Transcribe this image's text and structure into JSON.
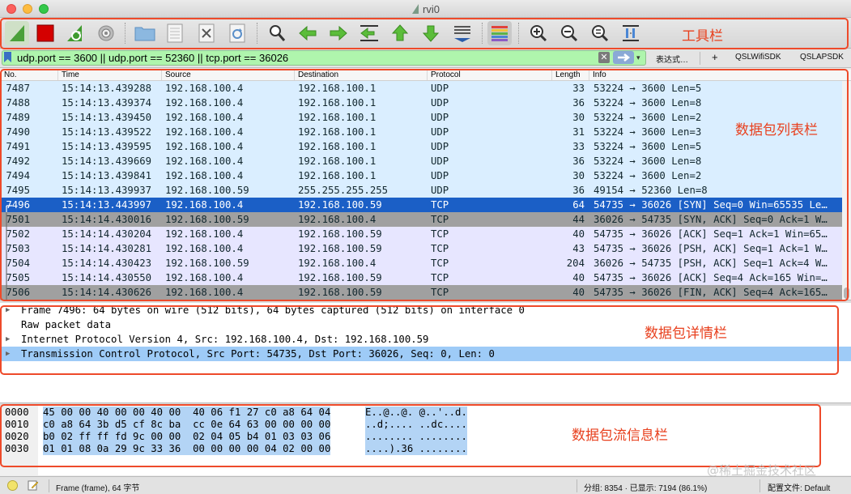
{
  "window": {
    "title": "rvi0"
  },
  "filter": {
    "value": "udp.port == 3600 || udp.port == 52360 || tcp.port == 36026",
    "expression_label": "表达式…",
    "add_label": "+",
    "buttons": [
      "QSLWifiSDK",
      "QSLAPSDK"
    ]
  },
  "columns": [
    "No.",
    "Time",
    "Source",
    "Destination",
    "Protocol",
    "Length",
    "Info"
  ],
  "packets": [
    {
      "no": "7487",
      "time": "15:14:13.439288",
      "src": "192.168.100.4",
      "dst": "192.168.100.1",
      "proto": "UDP",
      "len": "33",
      "info": "53224 → 3600 Len=5",
      "bg": "#daeeff",
      "fg": "#12272e"
    },
    {
      "no": "7488",
      "time": "15:14:13.439374",
      "src": "192.168.100.4",
      "dst": "192.168.100.1",
      "proto": "UDP",
      "len": "36",
      "info": "53224 → 3600 Len=8",
      "bg": "#daeeff",
      "fg": "#12272e"
    },
    {
      "no": "7489",
      "time": "15:14:13.439450",
      "src": "192.168.100.4",
      "dst": "192.168.100.1",
      "proto": "UDP",
      "len": "30",
      "info": "53224 → 3600 Len=2",
      "bg": "#daeeff",
      "fg": "#12272e"
    },
    {
      "no": "7490",
      "time": "15:14:13.439522",
      "src": "192.168.100.4",
      "dst": "192.168.100.1",
      "proto": "UDP",
      "len": "31",
      "info": "53224 → 3600 Len=3",
      "bg": "#daeeff",
      "fg": "#12272e"
    },
    {
      "no": "7491",
      "time": "15:14:13.439595",
      "src": "192.168.100.4",
      "dst": "192.168.100.1",
      "proto": "UDP",
      "len": "33",
      "info": "53224 → 3600 Len=5",
      "bg": "#daeeff",
      "fg": "#12272e"
    },
    {
      "no": "7492",
      "time": "15:14:13.439669",
      "src": "192.168.100.4",
      "dst": "192.168.100.1",
      "proto": "UDP",
      "len": "36",
      "info": "53224 → 3600 Len=8",
      "bg": "#daeeff",
      "fg": "#12272e"
    },
    {
      "no": "7494",
      "time": "15:14:13.439841",
      "src": "192.168.100.4",
      "dst": "192.168.100.1",
      "proto": "UDP",
      "len": "30",
      "info": "53224 → 3600 Len=2",
      "bg": "#daeeff",
      "fg": "#12272e"
    },
    {
      "no": "7495",
      "time": "15:14:13.439937",
      "src": "192.168.100.59",
      "dst": "255.255.255.255",
      "proto": "UDP",
      "len": "36",
      "info": "49154 → 52360 Len=8",
      "bg": "#daeeff",
      "fg": "#12272e"
    },
    {
      "no": "7496",
      "time": "15:14:13.443997",
      "src": "192.168.100.4",
      "dst": "192.168.100.59",
      "proto": "TCP",
      "len": "64",
      "info": "54735 → 36026 [SYN] Seq=0 Win=65535 Le…",
      "bg": "#1b5fc6",
      "fg": "#ffffff"
    },
    {
      "no": "7501",
      "time": "15:14:14.430016",
      "src": "192.168.100.59",
      "dst": "192.168.100.4",
      "proto": "TCP",
      "len": "44",
      "info": "36026 → 54735 [SYN, ACK] Seq=0 Ack=1 W…",
      "bg": "#a0a0a0",
      "fg": "#12272e"
    },
    {
      "no": "7502",
      "time": "15:14:14.430204",
      "src": "192.168.100.4",
      "dst": "192.168.100.59",
      "proto": "TCP",
      "len": "40",
      "info": "54735 → 36026 [ACK] Seq=1 Ack=1 Win=65…",
      "bg": "#e7e6ff",
      "fg": "#12272e"
    },
    {
      "no": "7503",
      "time": "15:14:14.430281",
      "src": "192.168.100.4",
      "dst": "192.168.100.59",
      "proto": "TCP",
      "len": "43",
      "info": "54735 → 36026 [PSH, ACK] Seq=1 Ack=1 W…",
      "bg": "#e7e6ff",
      "fg": "#12272e"
    },
    {
      "no": "7504",
      "time": "15:14:14.430423",
      "src": "192.168.100.59",
      "dst": "192.168.100.4",
      "proto": "TCP",
      "len": "204",
      "info": "36026 → 54735 [PSH, ACK] Seq=1 Ack=4 W…",
      "bg": "#e7e6ff",
      "fg": "#12272e"
    },
    {
      "no": "7505",
      "time": "15:14:14.430550",
      "src": "192.168.100.4",
      "dst": "192.168.100.59",
      "proto": "TCP",
      "len": "40",
      "info": "54735 → 36026 [ACK] Seq=4 Ack=165 Win=…",
      "bg": "#e7e6ff",
      "fg": "#12272e"
    },
    {
      "no": "7506",
      "time": "15:14:14.430626",
      "src": "192.168.100.4",
      "dst": "192.168.100.59",
      "proto": "TCP",
      "len": "40",
      "info": "54735 → 36026 [FIN, ACK] Seq=4 Ack=165…",
      "bg": "#a0a0a0",
      "fg": "#12272e"
    }
  ],
  "details": [
    {
      "text": "Frame 7496: 64 bytes on wire (512 bits), 64 bytes captured (512 bits) on interface 0",
      "expandable": true,
      "selected": false
    },
    {
      "text": "Raw packet data",
      "expandable": false,
      "selected": false
    },
    {
      "text": "Internet Protocol Version 4, Src: 192.168.100.4, Dst: 192.168.100.59",
      "expandable": true,
      "selected": false
    },
    {
      "text": "Transmission Control Protocol, Src Port: 54735, Dst Port: 36026, Seq: 0, Len: 0",
      "expandable": true,
      "selected": true
    }
  ],
  "bytes": [
    {
      "offset": "0000",
      "hex": "45 00 00 40 00 00 40 00  40 06 f1 27 c0 a8 64 04",
      "ascii": "E..@..@. @..'..d."
    },
    {
      "offset": "0010",
      "hex": "c0 a8 64 3b d5 cf 8c ba  cc 0e 64 63 00 00 00 00",
      "ascii": "..d;.... ..dc...."
    },
    {
      "offset": "0020",
      "hex": "b0 02 ff ff fd 9c 00 00  02 04 05 b4 01 03 03 06",
      "ascii": "........ ........"
    },
    {
      "offset": "0030",
      "hex": "01 01 08 0a 29 9c 33 36  00 00 00 00 04 02 00 00",
      "ascii": "....).36 ........"
    }
  ],
  "status": {
    "frame_text": "Frame (frame), 64 字节",
    "counts": "分组: 8354 · 已显示: 7194 (86.1%)",
    "profile": "配置文件: Default"
  },
  "annotations": {
    "toolbar": "工具栏",
    "list": "数据包列表栏",
    "detail": "数据包详情栏",
    "bytes": "数据包流信息栏",
    "color": "#ee4a2a"
  },
  "watermark": "@稀土掘金技术社区",
  "icons": [
    "shark-fin-icon",
    "stop-icon",
    "restart-icon",
    "options-icon",
    "folder-icon",
    "file-icon",
    "close-file-icon",
    "reload-icon",
    "find-icon",
    "back-icon",
    "forward-icon",
    "go-to-packet-icon",
    "first-packet-icon",
    "last-packet-icon",
    "autoscroll-icon",
    "colorize-icon",
    "zoom-in-icon",
    "zoom-out-icon",
    "zoom-reset-icon",
    "resize-columns-icon"
  ]
}
